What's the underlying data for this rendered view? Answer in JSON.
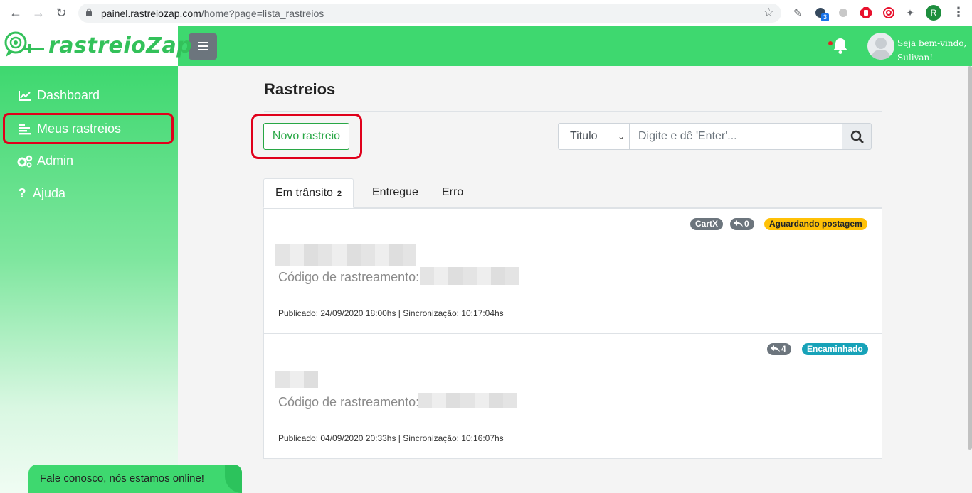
{
  "browser": {
    "url_host": "painel.rastreiozap.com",
    "url_path": "/home?page=lista_rastreios",
    "extension_badge": "3",
    "profile_initial": "R"
  },
  "header": {
    "logo_text": "rastreioZap",
    "welcome_line1": "Seja bem-vindo,",
    "welcome_line2": "Sulivan!"
  },
  "sidebar": {
    "items": [
      {
        "label": "Dashboard",
        "icon": "chart-line-icon"
      },
      {
        "label": "Meus rastreios",
        "icon": "list-icon"
      },
      {
        "label": "Admin",
        "icon": "gears-icon"
      },
      {
        "label": "Ajuda",
        "icon": "question-icon"
      }
    ]
  },
  "main": {
    "title": "Rastreios",
    "new_button": "Novo rastreio",
    "search": {
      "select_value": "Titulo",
      "placeholder": "Digite e dê 'Enter'..."
    },
    "tabs": [
      {
        "label": "Em trânsito",
        "count": "2"
      },
      {
        "label": "Entregue"
      },
      {
        "label": "Erro"
      }
    ],
    "items": [
      {
        "badges": [
          "CartX",
          "0",
          "Aguardando postagem"
        ],
        "code_label": "Código de rastreamento:",
        "meta": "Publicado: 24/09/2020 18:00hs | Sincronização: 10:17:04hs"
      },
      {
        "badges": [
          "4",
          "Encaminhado"
        ],
        "code_label": "Código de rastreamento:",
        "meta": "Publicado: 04/09/2020 20:33hs | Sincronização: 10:16:07hs"
      }
    ]
  },
  "chat": {
    "label": "Fale conosco, nós estamos online!"
  },
  "colors": {
    "brand_green": "#3ed86f",
    "highlight_red": "#e0001b",
    "badge_yellow": "#ffc107",
    "badge_teal": "#17a2b8"
  }
}
